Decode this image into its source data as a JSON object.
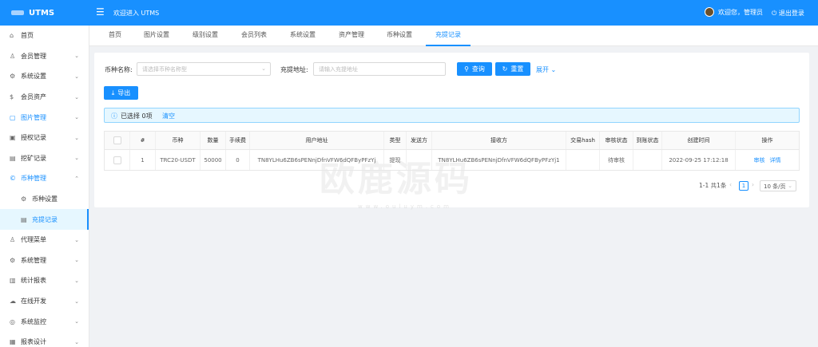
{
  "app": {
    "logo": "UTMS",
    "welcome": "欢迎进入 UTMS"
  },
  "header": {
    "user_greeting": "欢迎您，管理员",
    "logout": "退出登录"
  },
  "sidebar": {
    "items": [
      {
        "label": "首页",
        "icon": "home-icon"
      },
      {
        "label": "会员管理",
        "icon": "user-icon"
      },
      {
        "label": "系统设置",
        "icon": "gear-icon"
      },
      {
        "label": "会员资产",
        "icon": "dollar-icon"
      },
      {
        "label": "图片管理",
        "icon": "image-icon"
      },
      {
        "label": "授权记录",
        "icon": "picture-icon"
      },
      {
        "label": "挖矿记录",
        "icon": "document-icon"
      },
      {
        "label": "币种管理",
        "icon": "coin-icon"
      },
      {
        "label": "币种设置",
        "icon": "gear-icon"
      },
      {
        "label": "充提记录",
        "icon": "record-icon"
      },
      {
        "label": "代理菜单",
        "icon": "user-icon"
      },
      {
        "label": "系统管理",
        "icon": "gear-icon"
      },
      {
        "label": "统计报表",
        "icon": "chart-icon"
      },
      {
        "label": "在线开发",
        "icon": "cloud-icon"
      },
      {
        "label": "系统监控",
        "icon": "monitor-icon"
      },
      {
        "label": "报表设计",
        "icon": "bar-chart-icon"
      }
    ]
  },
  "tabs": [
    "首页",
    "图片设置",
    "级别设置",
    "会员列表",
    "系统设置",
    "资产管理",
    "币种设置",
    "充提记录"
  ],
  "filters": {
    "coin_label": "币种名称:",
    "coin_placeholder": "请选择币种名称型",
    "address_label": "充提地址:",
    "address_placeholder": "请输入充提地址",
    "search_button": "查询",
    "reset_button": "重置",
    "expand": "展开"
  },
  "export_button": "导出",
  "selection": {
    "text": "已选择 0项",
    "clear": "清空"
  },
  "table": {
    "columns": [
      "#",
      "币种",
      "数量",
      "手续费",
      "用户地址",
      "类型",
      "发送方",
      "接收方",
      "交易hash",
      "审核状态",
      "到账状态",
      "创建时间",
      "操作"
    ],
    "rows": [
      {
        "index": "1",
        "coin": "TRC20-USDT",
        "amount": "50000",
        "fee": "0",
        "user_address": "TN8YLHu6ZB6sPENnjDfnVFW6dQFByPFzYj",
        "type": "提现",
        "sender": "",
        "receiver": "TN8YLHu6ZB6sPENnjDfnVFW6dQFByPFzYj1",
        "tx_hash": "",
        "audit_status": "待审核",
        "arrival_status": "",
        "created_at": "2022-09-25 17:12:18",
        "actions": [
          "审核",
          "详情"
        ]
      }
    ]
  },
  "pagination": {
    "summary": "1-1 共1条",
    "current": "1",
    "page_size": "10 条/页"
  }
}
